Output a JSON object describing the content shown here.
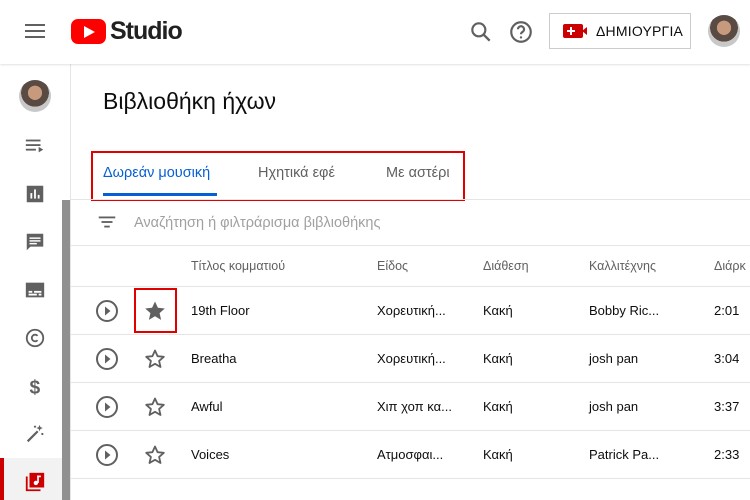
{
  "app": {
    "logo_text": "Studio"
  },
  "header": {
    "create_label": "ΔΗΜΙΟΥΡΓΙΑ",
    "icons": [
      "menu-icon",
      "search-icon",
      "help-icon",
      "create-video-icon",
      "avatar"
    ]
  },
  "sidebar": {
    "items": [
      {
        "name": "content-icon"
      },
      {
        "name": "analytics-icon"
      },
      {
        "name": "comments-icon"
      },
      {
        "name": "subtitles-icon"
      },
      {
        "name": "copyright-icon"
      },
      {
        "name": "monetization-icon"
      },
      {
        "name": "customization-icon"
      },
      {
        "name": "audio-library-icon",
        "active": true
      }
    ]
  },
  "page": {
    "title": "Βιβλιοθήκη ήχων"
  },
  "tabs": [
    {
      "label": "Δωρεάν μουσική",
      "active": true
    },
    {
      "label": "Ηχητικά εφέ",
      "active": false
    },
    {
      "label": "Με αστέρι",
      "active": false
    }
  ],
  "filter": {
    "placeholder": "Αναζήτηση ή φιλτράρισμα βιβλιοθήκης"
  },
  "table": {
    "columns": [
      "Τίτλος κομματιού",
      "Είδος",
      "Διάθεση",
      "Καλλιτέχνης",
      "Διάρκ"
    ],
    "rows": [
      {
        "title": "19th Floor",
        "genre": "Χορευτική...",
        "mood": "Κακή",
        "artist": "Bobby Ric...",
        "duration": "2:01",
        "starred": true
      },
      {
        "title": "Breatha",
        "genre": "Χορευτική...",
        "mood": "Κακή",
        "artist": "josh pan",
        "duration": "3:04",
        "starred": false
      },
      {
        "title": "Awful",
        "genre": "Χιπ χοπ κα...",
        "mood": "Κακή",
        "artist": "josh pan",
        "duration": "3:37",
        "starred": false
      },
      {
        "title": "Voices",
        "genre": "Ατμοσφαι...",
        "mood": "Κακή",
        "artist": "Patrick Pa...",
        "duration": "2:33",
        "starred": false
      }
    ]
  },
  "colors": {
    "brand_red": "#ff0000",
    "accent_blue": "#065fd4",
    "highlight_red": "#e00000"
  }
}
